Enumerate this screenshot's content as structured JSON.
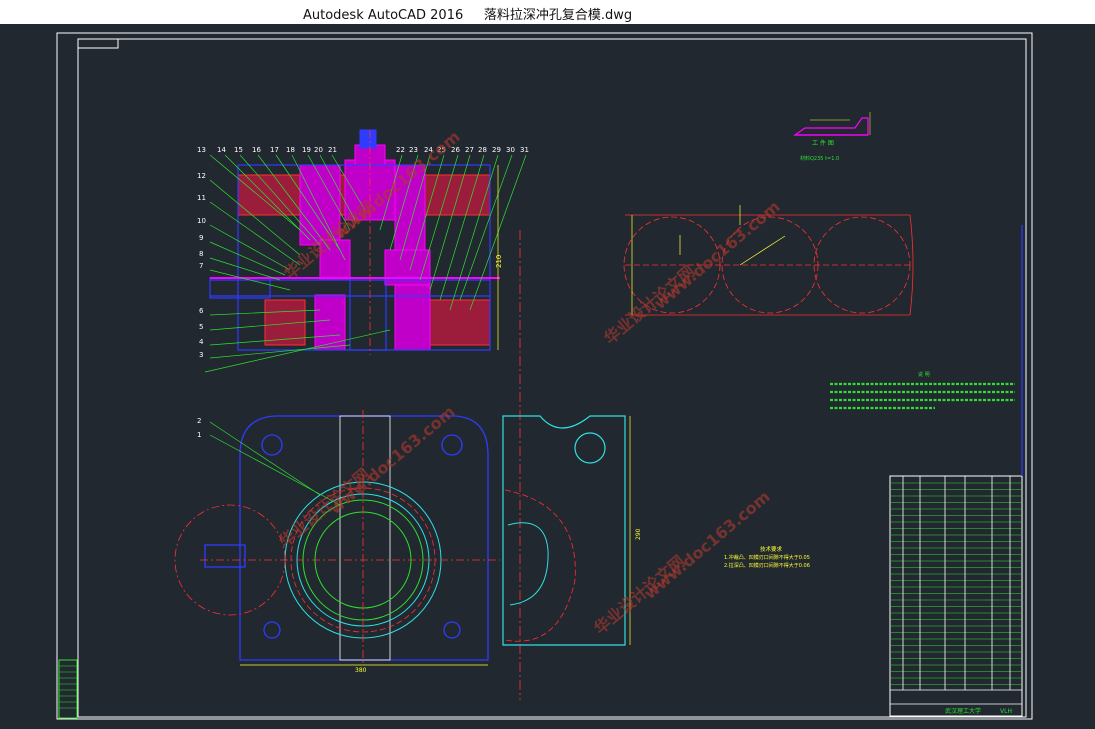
{
  "window": {
    "title": "Autodesk AutoCAD 2016     落料拉深冲孔复合模.dwg"
  },
  "workpiece": {
    "label": "工 件 图",
    "material": "材料Q235 t=1.0"
  },
  "part_numbers": {
    "top": [
      "13",
      "14",
      "15",
      "16",
      "17",
      "18",
      "19",
      "20",
      "21",
      "22",
      "23",
      "24",
      "25",
      "26",
      "27",
      "28",
      "29",
      "30",
      "31"
    ],
    "left": [
      "12",
      "11",
      "10",
      "9",
      "8",
      "7",
      "6",
      "5",
      "4",
      "3"
    ],
    "bottom_left": [
      "2",
      "1"
    ]
  },
  "dimensions": {
    "main_height": "210",
    "plan_width": "380",
    "plan_height": "290"
  },
  "tech_requirements": {
    "title": "技术要求",
    "line1": "1.冲裁凸、凹模刃口间隙不得大于0.05",
    "line2": "2.拉深凸、凹模刃口间隙不得大于0.06"
  },
  "notes_title": "说 明",
  "title_block": {
    "school": "武汉理工大学",
    "code": "VLH"
  },
  "watermarks": [
    "华业设计论文网",
    "www.doc163.com"
  ],
  "colors": {
    "background": "#212830",
    "frame": "#ffffff",
    "blue": "#2f3cff",
    "magenta": "#ff00ff",
    "green": "#2fe02f",
    "red": "#ff3030",
    "yellow": "#ffff30",
    "cyan": "#30e0e0"
  }
}
